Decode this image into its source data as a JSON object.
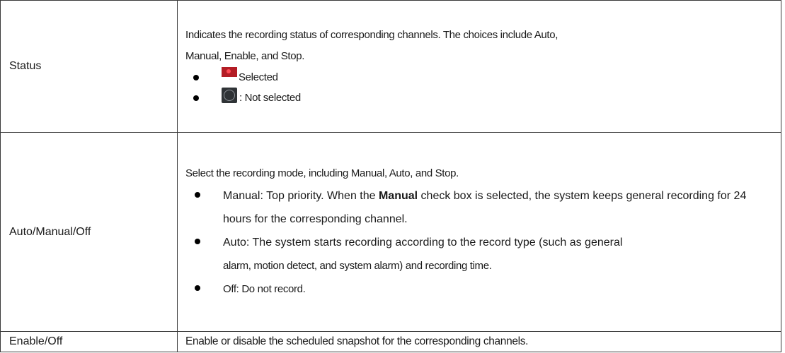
{
  "rows": [
    {
      "name": "Status",
      "intro_line1": "Indicates the recording status of corresponding channels. The choices include Auto,",
      "intro_line2": "Manual, Enable, and Stop.",
      "bullets": [
        {
          "icon": "selected-status-icon",
          "text": "Selected"
        },
        {
          "icon": "not-selected-status-icon",
          "text": ": Not selected"
        }
      ]
    },
    {
      "name": "Auto/Manual/Off",
      "intro": "Select the recording mode, including Manual, Auto, and Stop.",
      "manual": {
        "term": "Manual",
        "pre": ": Top priority. When the ",
        "bold": "Manual",
        "post": " check box is selected, the system keeps general recording for 24 hours for the corresponding channel."
      },
      "auto": {
        "line1": "Auto: The system starts recording according to the record type (such as general",
        "line2": "alarm, motion detect, and system alarm) and recording time."
      },
      "off": "Off: Do not record."
    },
    {
      "name": "Enable/Off",
      "desc": "Enable or disable the scheduled snapshot for the corresponding channels."
    }
  ],
  "colors": {
    "selected_icon": "#b31d25",
    "unselected_icon": "#2f3336",
    "border": "#3a3a3a"
  }
}
